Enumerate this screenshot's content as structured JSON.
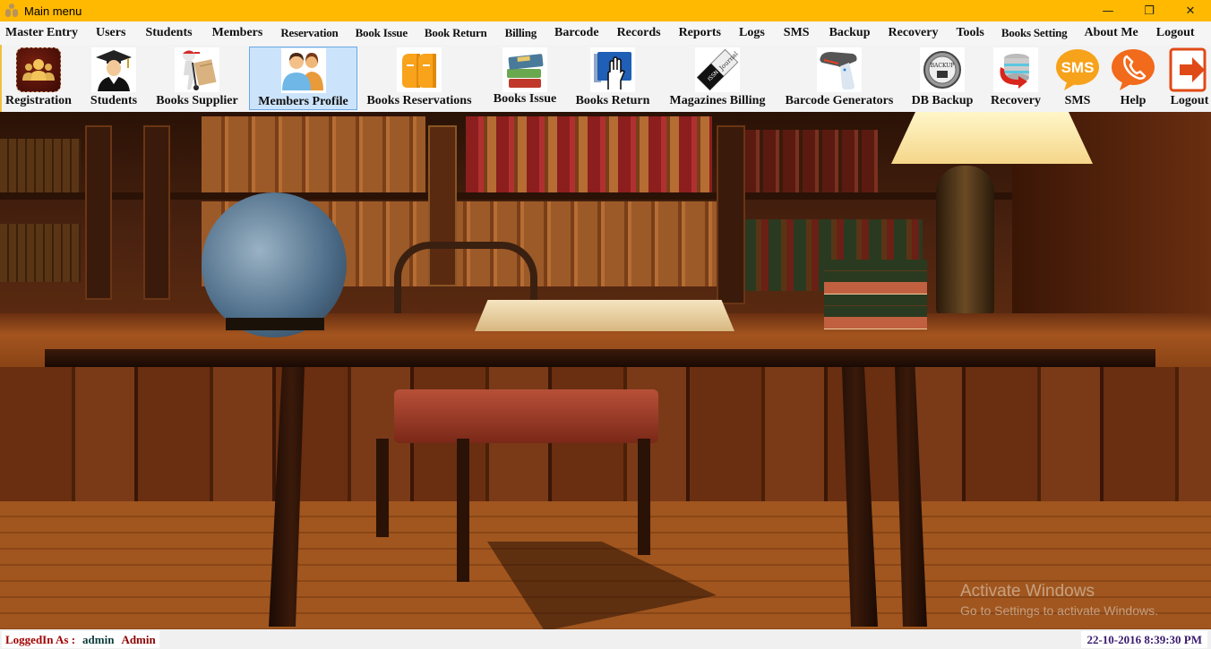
{
  "window": {
    "title": "Main menu",
    "controls": {
      "minimize": "—",
      "restore": "❐",
      "close": "✕"
    }
  },
  "menu": [
    {
      "label": "Master Entry"
    },
    {
      "label": "Users"
    },
    {
      "label": "Students"
    },
    {
      "label": "Members"
    },
    {
      "label": "Reservation"
    },
    {
      "label": "Book Issue"
    },
    {
      "label": "Book Return"
    },
    {
      "label": "Billing"
    },
    {
      "label": "Barcode"
    },
    {
      "label": "Records"
    },
    {
      "label": "Reports"
    },
    {
      "label": "Logs"
    },
    {
      "label": "SMS"
    },
    {
      "label": "Backup"
    },
    {
      "label": "Recovery"
    },
    {
      "label": "Tools"
    },
    {
      "label": "Books Setting"
    },
    {
      "label": "About Me"
    },
    {
      "label": "Logout"
    }
  ],
  "toolbar": [
    {
      "label": "Registration",
      "icon": "registration-icon"
    },
    {
      "label": "Students",
      "icon": "graduate-icon"
    },
    {
      "label": "Books Supplier",
      "icon": "delivery-man-icon"
    },
    {
      "label": "Members Profile",
      "icon": "members-icon",
      "selected": true
    },
    {
      "label": "Books Reservations",
      "icon": "books-orange-icon"
    },
    {
      "label": "Books Issue",
      "icon": "book-stack-icon"
    },
    {
      "label": "Books Return",
      "icon": "book-hand-icon"
    },
    {
      "label": "Magazines Billing",
      "icon": "journal-icon"
    },
    {
      "label": "Barcode Generators",
      "icon": "barcode-scanner-icon"
    },
    {
      "label": "DB Backup",
      "icon": "backup-icon"
    },
    {
      "label": "Recovery",
      "icon": "database-recovery-icon"
    },
    {
      "label": "SMS",
      "icon": "sms-bubble-icon",
      "icon_text": "SMS"
    },
    {
      "label": "Help",
      "icon": "phone-bubble-icon"
    },
    {
      "label": "Logout",
      "icon": "logout-icon"
    }
  ],
  "status": {
    "logged_in_label": "LoggedIn As :",
    "username": "admin",
    "role": "Admin",
    "datetime": "22-10-2016 8:39:30 PM"
  },
  "watermark": {
    "title": "Activate Windows",
    "subtitle": "Go to Settings to activate Windows."
  },
  "colors": {
    "titlebar": "#ffb900",
    "selected_tool_bg": "#cce4fb",
    "selected_tool_border": "#6aa9e6",
    "login_label": "#a00000",
    "datetime": "#3a1a6e"
  }
}
